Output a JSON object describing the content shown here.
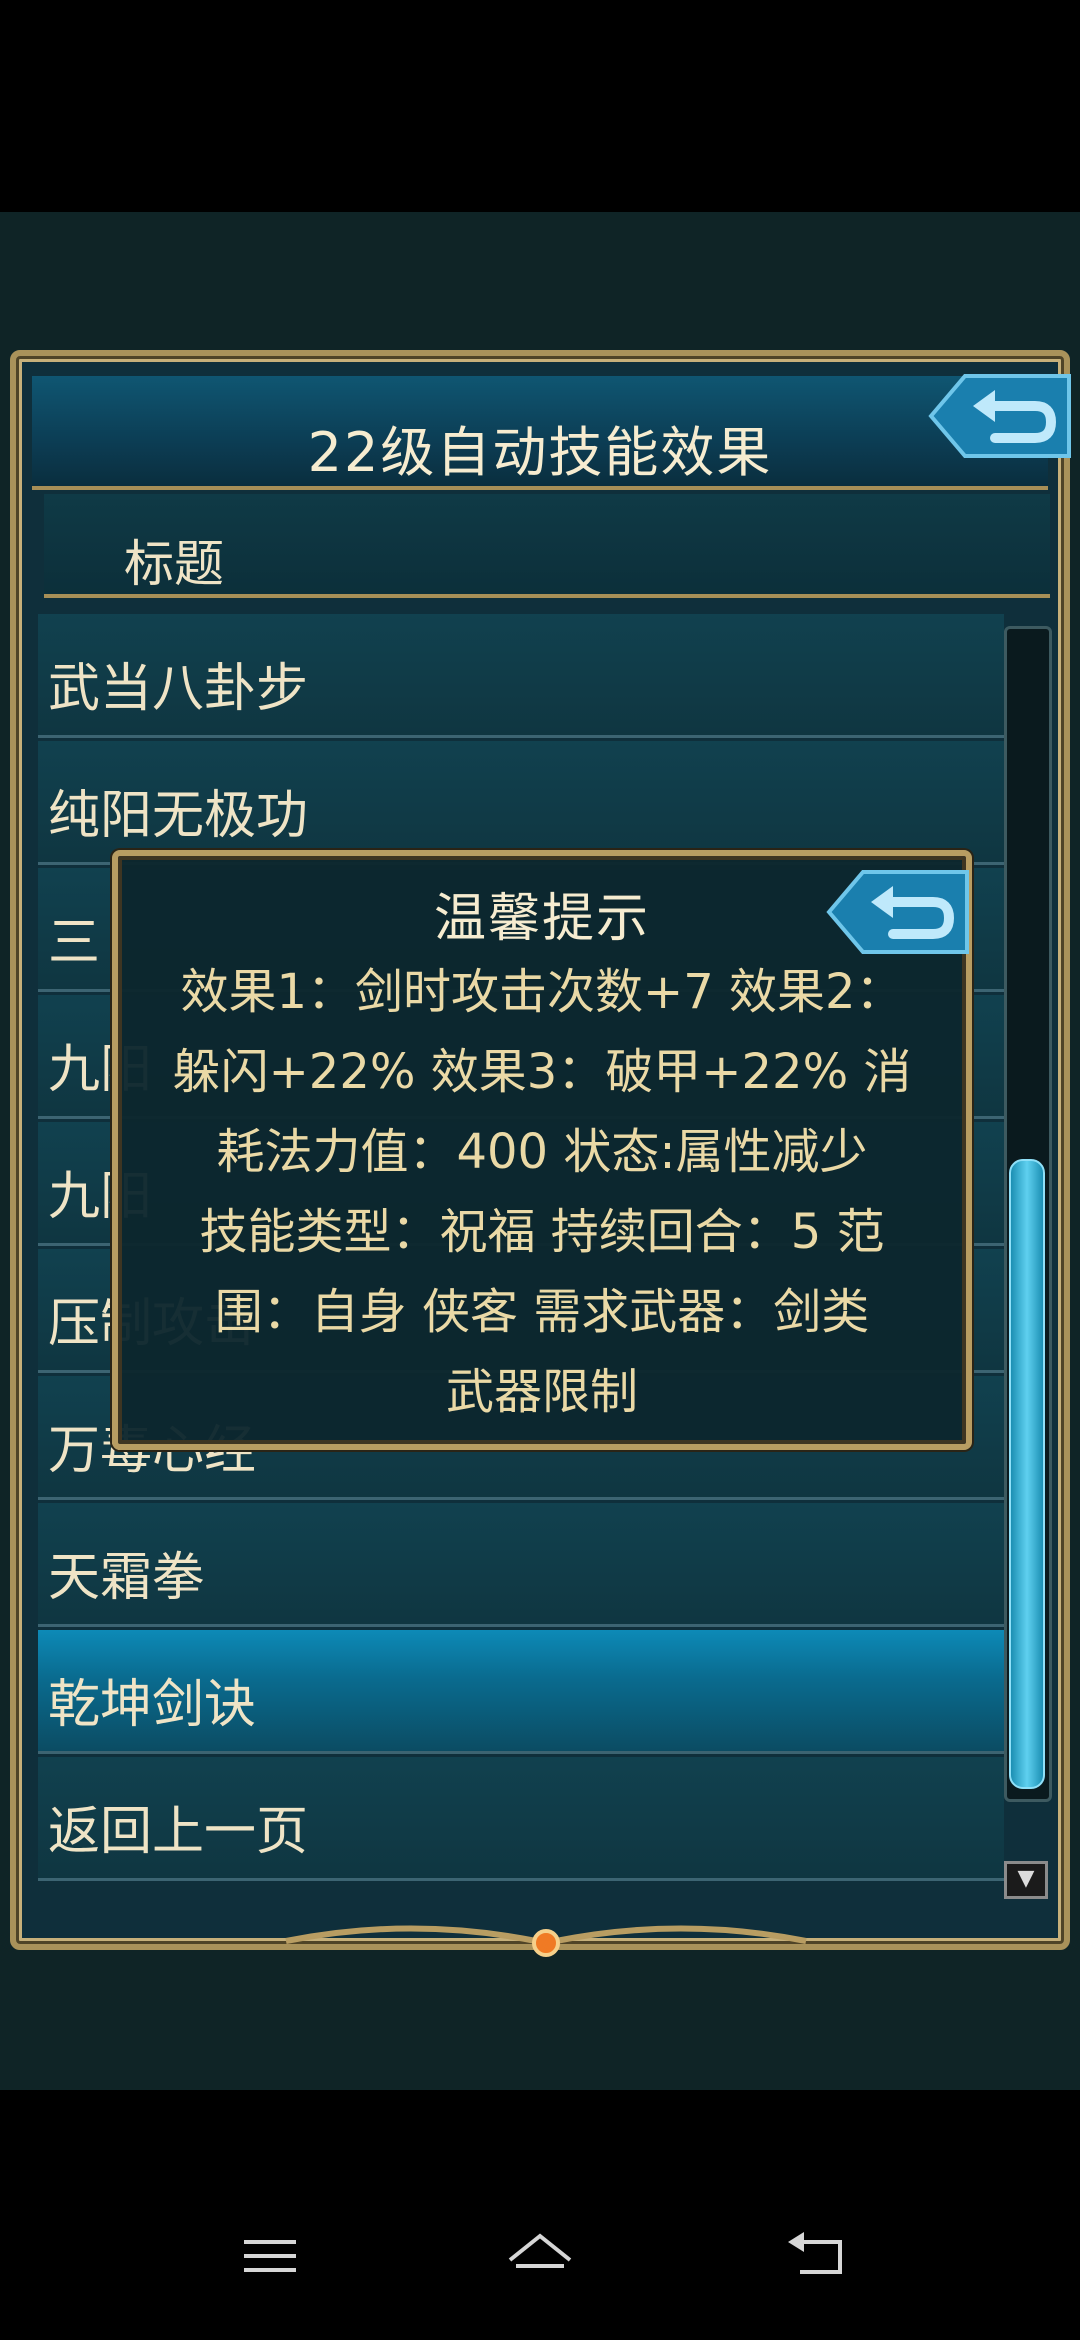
{
  "panel": {
    "title": "22级自动技能效果",
    "header_label": "标题"
  },
  "list": {
    "items": [
      {
        "label": "武当八卦步",
        "selected": false
      },
      {
        "label": "纯阳无极功",
        "selected": false
      },
      {
        "label": "三",
        "selected": false
      },
      {
        "label": "九阳",
        "selected": false
      },
      {
        "label": "九阳",
        "selected": false
      },
      {
        "label": "压制攻击",
        "selected": false
      },
      {
        "label": "万毒心经",
        "selected": false
      },
      {
        "label": "天霜拳",
        "selected": false
      },
      {
        "label": "乾坤剑诀",
        "selected": true
      },
      {
        "label": "返回上一页",
        "selected": false
      }
    ]
  },
  "popup": {
    "title": "温馨提示",
    "lines": [
      "效果1：剑时攻击次数+7  效果2：",
      "躲闪+22%  效果3：破甲+22%  消",
      "耗法力值：400  状态:属性减少",
      "技能类型：祝福  持续回合：5  范",
      "围：自身  侠客  需求武器：剑类",
      "武器限制"
    ]
  },
  "icons": {
    "back": "back-arrow-icon",
    "scroll_up": "scroll-up-icon",
    "scroll_down": "scroll-down-icon",
    "nav_menu": "menu-icon",
    "nav_home": "home-icon",
    "nav_back": "back-icon"
  },
  "colors": {
    "gold_border": "#a9925a",
    "selected_row": "#0d8ab7",
    "text": "#efe4c6"
  }
}
